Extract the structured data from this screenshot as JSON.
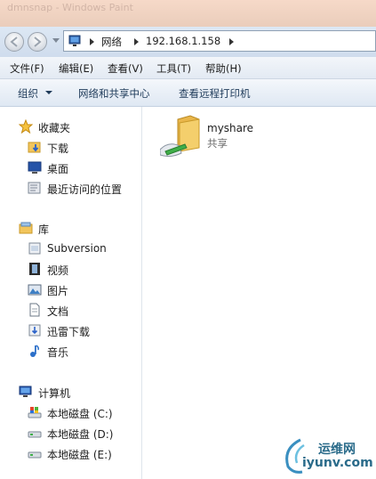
{
  "window": {
    "title_faint": "dmnsnap - Windows Paint"
  },
  "address_bar": {
    "crumbs": [
      "网络",
      "192.168.1.158"
    ]
  },
  "menubar": {
    "items": [
      "文件(F)",
      "编辑(E)",
      "查看(V)",
      "工具(T)",
      "帮助(H)"
    ]
  },
  "toolbar": {
    "organize_label": "组织",
    "network_center_label": "网络和共享中心",
    "remote_printers_label": "查看远程打印机"
  },
  "nav_pane": {
    "favorites": {
      "header": "收藏夹",
      "items": [
        "下载",
        "桌面",
        "最近访问的位置"
      ]
    },
    "libraries": {
      "header": "库",
      "items": [
        "Subversion",
        "视频",
        "图片",
        "文档",
        "迅雷下载",
        "音乐"
      ]
    },
    "computer": {
      "header": "计算机",
      "items": [
        "本地磁盘 (C:)",
        "本地磁盘 (D:)",
        "本地磁盘 (E:)"
      ]
    }
  },
  "content": {
    "share": {
      "name": "myshare",
      "type": "共享"
    }
  },
  "watermark": {
    "line1": "运维网",
    "line2": "iyunv.com"
  },
  "colors": {
    "accent": "#1f3b5a",
    "folder": "#f2c55c",
    "title_band": "#f6d9c8"
  }
}
